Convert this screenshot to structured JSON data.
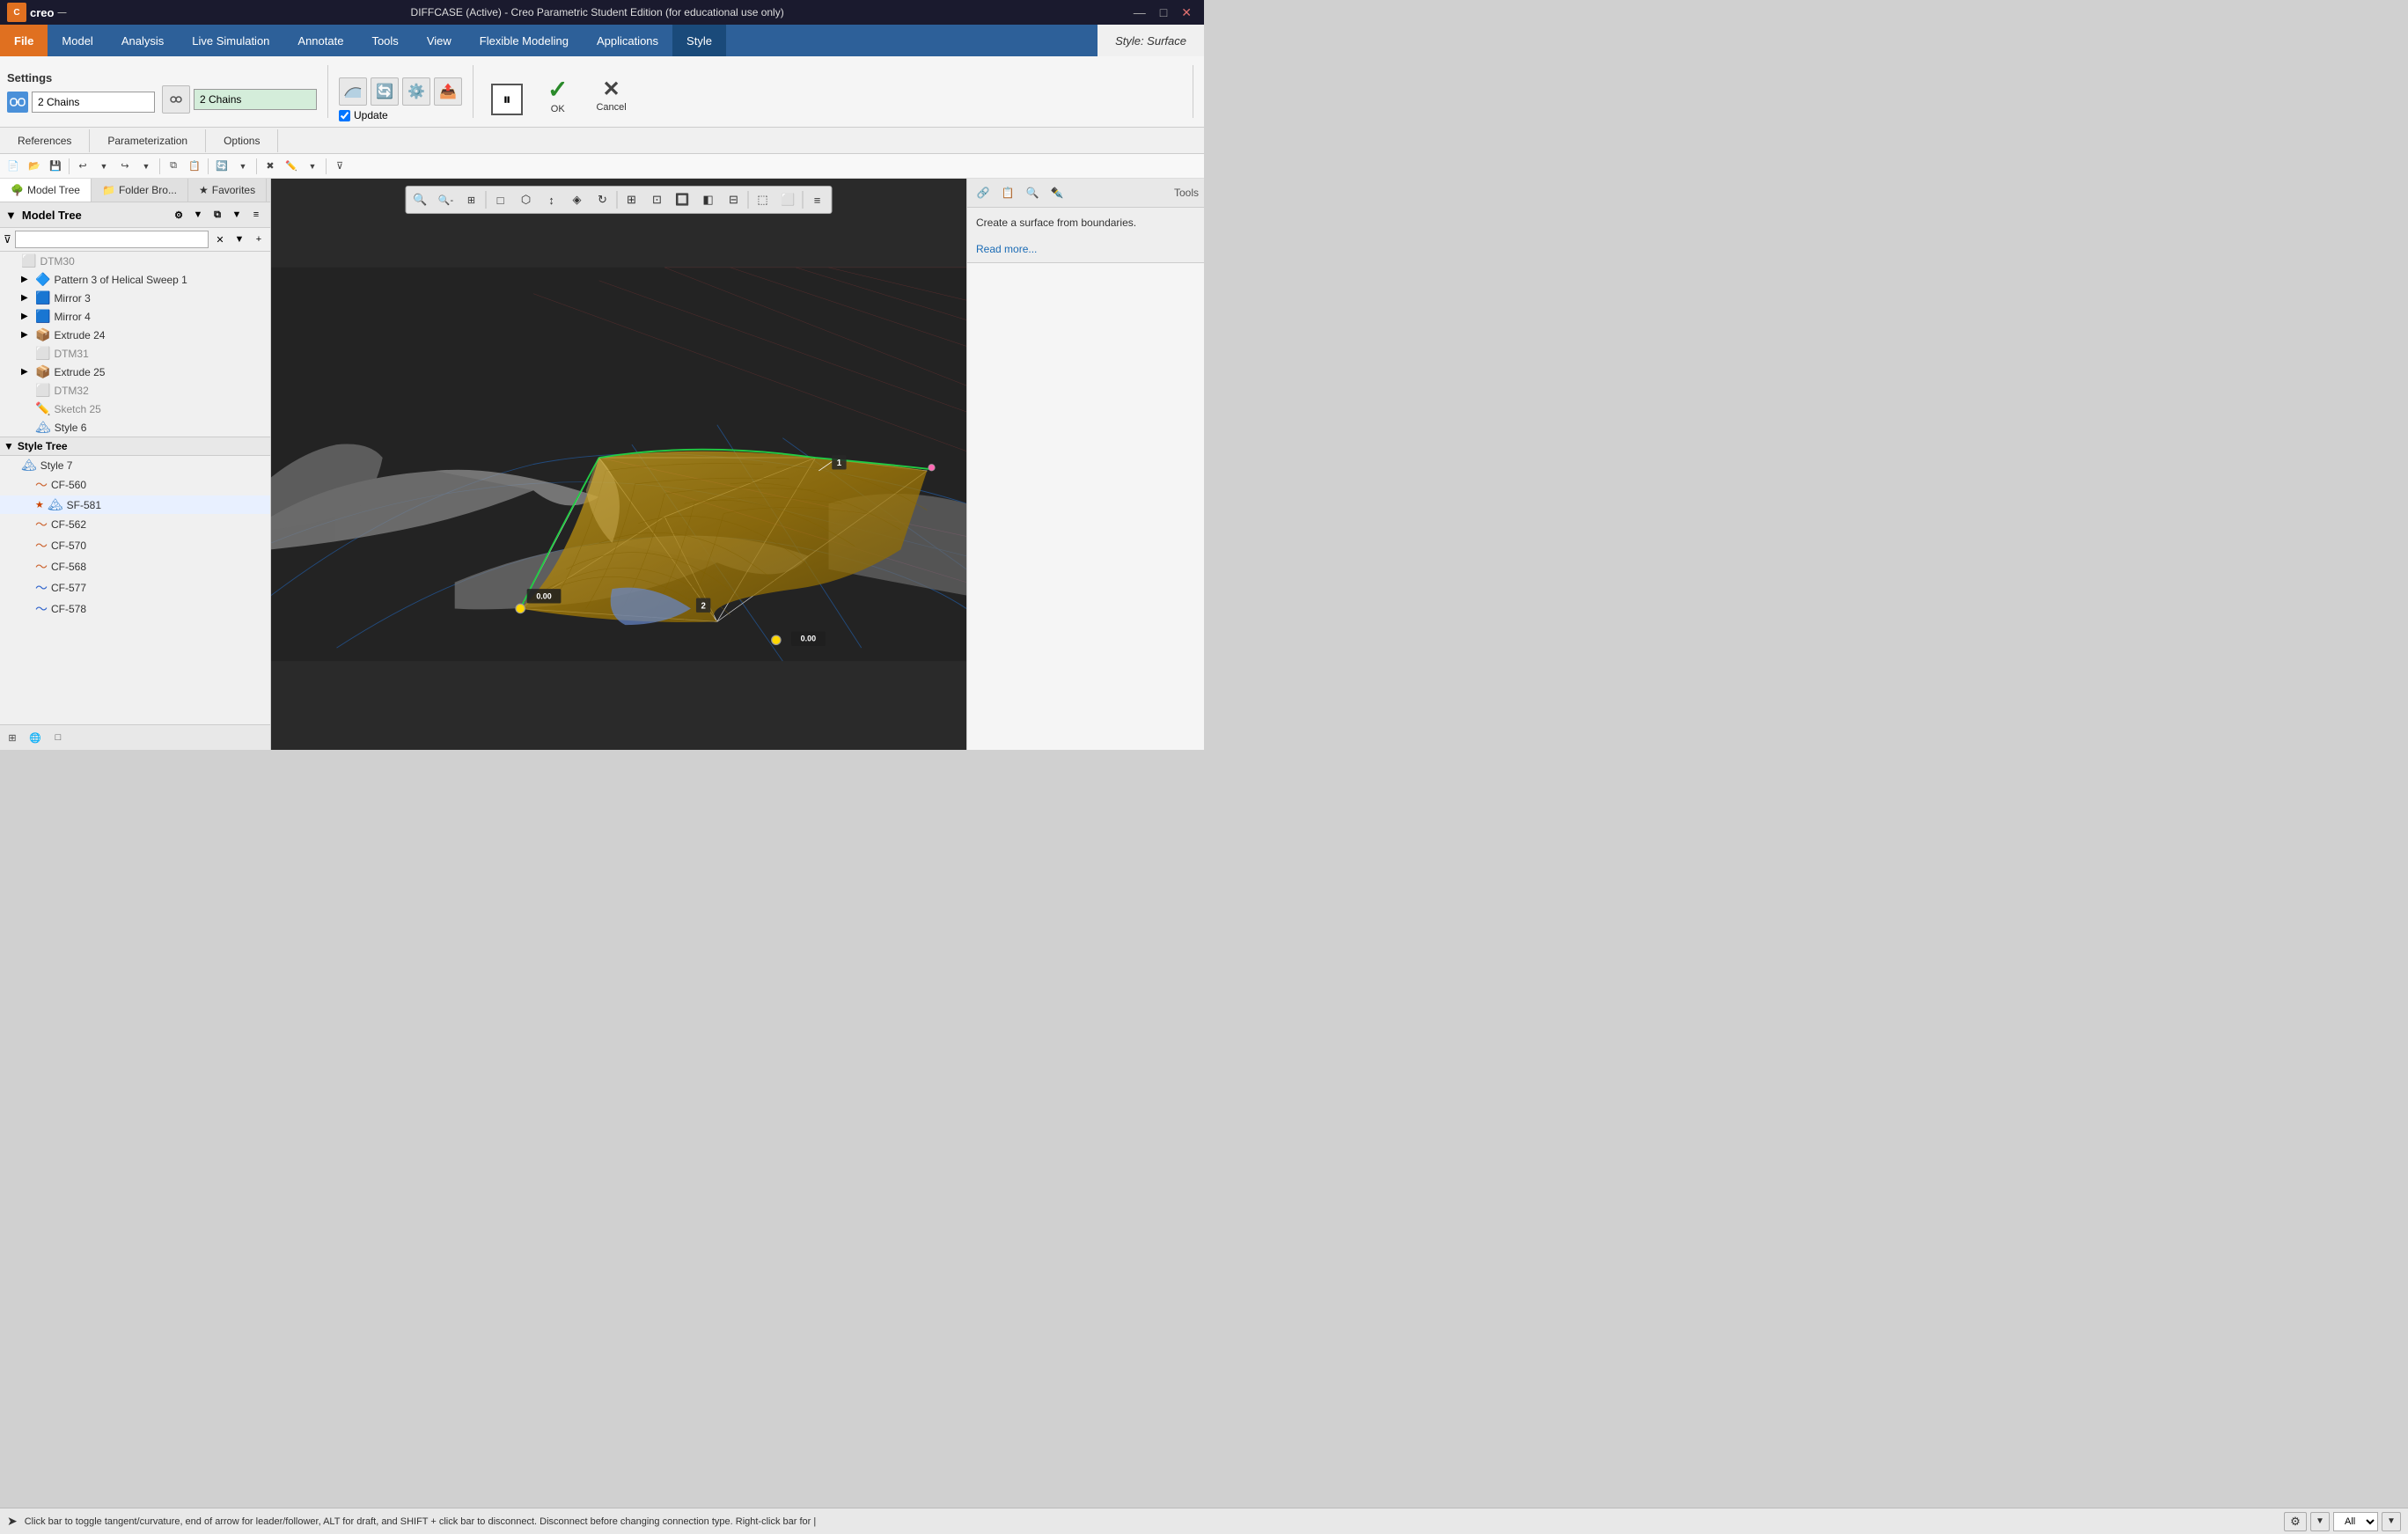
{
  "title_bar": {
    "title": "DIFFCASE (Active) - Creo Parametric Student Edition (for educational use only)",
    "controls": [
      "—",
      "□",
      "✕"
    ]
  },
  "menu": {
    "items": [
      {
        "label": "File",
        "class": "file"
      },
      {
        "label": "Model",
        "class": ""
      },
      {
        "label": "Analysis",
        "class": ""
      },
      {
        "label": "Live Simulation",
        "class": ""
      },
      {
        "label": "Annotate",
        "class": ""
      },
      {
        "label": "Tools",
        "class": ""
      },
      {
        "label": "View",
        "class": ""
      },
      {
        "label": "Flexible Modeling",
        "class": ""
      },
      {
        "label": "Applications",
        "class": ""
      },
      {
        "label": "Style",
        "class": "active"
      },
      {
        "label": "Style: Surface",
        "class": "style-surface"
      }
    ]
  },
  "ribbon": {
    "settings_label": "Settings",
    "chain1": {
      "label": "2 Chains",
      "icon": "↓"
    },
    "chain2": {
      "label": "2 Chains",
      "icon": "↓"
    },
    "update_label": "Update",
    "ok_label": "OK",
    "cancel_label": "Cancel",
    "pause_icon": "⏸"
  },
  "sub_tabs": [
    {
      "label": "References",
      "active": false
    },
    {
      "label": "Parameterization",
      "active": false
    },
    {
      "label": "Options",
      "active": false
    }
  ],
  "panel_tabs": [
    {
      "label": "Model Tree",
      "icon": "🌳",
      "active": true
    },
    {
      "label": "Folder Bro...",
      "icon": "📁",
      "active": false
    },
    {
      "label": "Favorites",
      "icon": "★",
      "active": false
    }
  ],
  "tree_header": "Model Tree",
  "model_tree": {
    "items": [
      {
        "indent": 0,
        "expand": "",
        "icon": "⬜",
        "label": "DTM30",
        "gray": true
      },
      {
        "indent": 0,
        "expand": "▶",
        "icon": "🔷",
        "label": "Pattern 3 of Helical Sweep 1",
        "gray": false
      },
      {
        "indent": 0,
        "expand": "▶",
        "icon": "🟦",
        "label": "Mirror 3",
        "gray": false
      },
      {
        "indent": 0,
        "expand": "▶",
        "icon": "🟦",
        "label": "Mirror 4",
        "gray": false
      },
      {
        "indent": 0,
        "expand": "▶",
        "icon": "📦",
        "label": "Extrude 24",
        "gray": false
      },
      {
        "indent": 1,
        "expand": "",
        "icon": "⬜",
        "label": "DTM31",
        "gray": true
      },
      {
        "indent": 0,
        "expand": "▶",
        "icon": "📦",
        "label": "Extrude 25",
        "gray": false
      },
      {
        "indent": 1,
        "expand": "",
        "icon": "⬜",
        "label": "DTM32",
        "gray": true
      },
      {
        "indent": 1,
        "expand": "",
        "icon": "✏️",
        "label": "Sketch 25",
        "gray": false
      },
      {
        "indent": 1,
        "expand": "",
        "icon": "🏔",
        "label": "Style 6",
        "gray": false
      }
    ]
  },
  "style_tree": {
    "header": "Style Tree",
    "items": [
      {
        "indent": 0,
        "icon": "🏔",
        "label": "Style 7",
        "gray": false
      },
      {
        "indent": 1,
        "icon": "〜",
        "label": "CF-560",
        "gray": false
      },
      {
        "indent": 1,
        "icon": "★",
        "label": "SF-581",
        "star": true,
        "gray": false
      },
      {
        "indent": 1,
        "icon": "〜",
        "label": "CF-562",
        "gray": false
      },
      {
        "indent": 1,
        "icon": "〜",
        "label": "CF-570",
        "gray": false
      },
      {
        "indent": 1,
        "icon": "〜",
        "label": "CF-568",
        "gray": false
      },
      {
        "indent": 1,
        "icon": "〜",
        "label": "CF-577",
        "gray": false,
        "blue": true
      },
      {
        "indent": 1,
        "icon": "〜",
        "label": "CF-578",
        "gray": false,
        "blue": true
      }
    ]
  },
  "right_panel": {
    "description": "Create a surface from boundaries.",
    "read_more": "Read more...",
    "icons": [
      "🔗",
      "📋",
      "🔍",
      "✒️"
    ],
    "tools_label": "Tools"
  },
  "viewport": {
    "label1": "1",
    "label2": "2",
    "value1": "0.00",
    "value2": "0.00"
  },
  "status_bar": {
    "text": "Click bar to toggle tangent/curvature, end of arrow for leader/follower, ALT for draft, and SHIFT + click bar to disconnect. Disconnect before changing connection type. Right-click bar for |",
    "zoom_label": "All"
  },
  "viewport_toolbar": {
    "buttons": [
      "🔍+",
      "🔍-",
      "🔍□",
      "□",
      "⬡",
      "↕",
      "◈",
      "↻",
      "⊞",
      "⊡",
      "🔲",
      "◧",
      "⊟",
      "⬚",
      "⬜",
      "≡"
    ]
  }
}
